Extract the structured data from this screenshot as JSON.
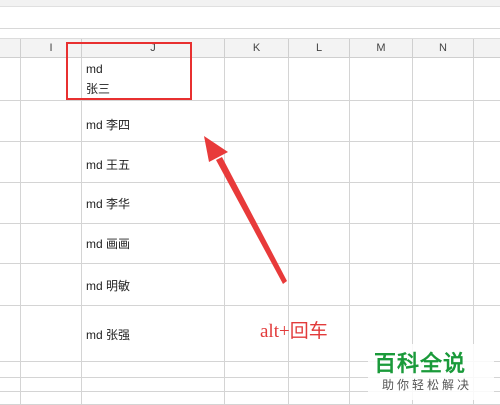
{
  "columns": [
    "I",
    "J",
    "K",
    "L",
    "M",
    "N"
  ],
  "cells": [
    {
      "line1": "md",
      "line2": "张三"
    },
    {
      "line1": "md 李四"
    },
    {
      "line1": "md 王五"
    },
    {
      "line1": "md 李华"
    },
    {
      "line1": "md 画画"
    },
    {
      "line1": "md 明敏"
    },
    {
      "line1": "md 张强"
    }
  ],
  "annotation": "alt+回车",
  "accent_color": "#e83030",
  "watermark": {
    "title": "百科全说",
    "subtitle": "助你轻松解决"
  }
}
